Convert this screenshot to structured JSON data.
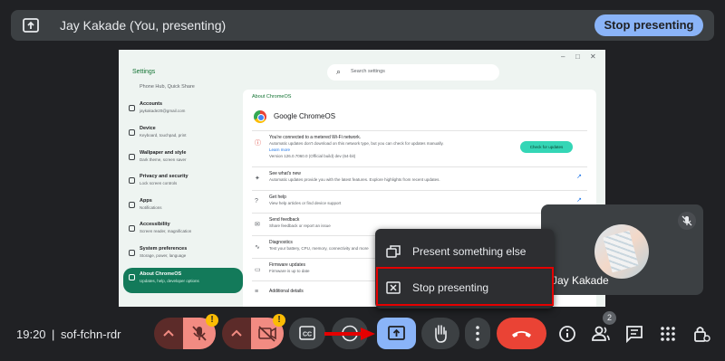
{
  "banner": {
    "title": "Jay Kakade (You, presenting)",
    "stop_label": "Stop presenting",
    "icon": "present-screen-icon"
  },
  "shared_screen": {
    "window_controls": [
      "–",
      "□",
      "✕"
    ],
    "settings_title": "Settings",
    "search_placeholder": "Search settings",
    "nav": [
      {
        "label": "Phone Hub, Quick Share",
        "sub": ""
      },
      {
        "label": "Accounts",
        "sub": "jaykakade20@gmail.com"
      },
      {
        "label": "Device",
        "sub": "Keyboard, touchpad, print"
      },
      {
        "label": "Wallpaper and style",
        "sub": "Dark theme, screen saver"
      },
      {
        "label": "Privacy and security",
        "sub": "Lock screen controls"
      },
      {
        "label": "Apps",
        "sub": "Notifications"
      },
      {
        "label": "Accessibility",
        "sub": "Screen reader, magnification"
      },
      {
        "label": "System preferences",
        "sub": "Storage, power, language"
      },
      {
        "label": "About ChromeOS",
        "sub": "Updates, help, developer options"
      }
    ],
    "panel_heading": "About ChromeOS",
    "product_name": "Google ChromeOS",
    "update_row": {
      "title": "You're connected to a metered Wi-Fi network.",
      "sub": "Automatic updates don't download on this network type, but you can check for updates manually.",
      "link": "Learn more",
      "version": "Version 126.0.7060.0 (Official build) dev (64-bit)",
      "button": "Check for updates"
    },
    "rows": [
      {
        "title": "See what's new",
        "sub": "Automatic updates provide you with the latest features. Explore highlights from recent updates.",
        "icon": "sparkle-icon"
      },
      {
        "title": "Get help",
        "sub": "View help articles or find device support",
        "icon": "help-icon"
      },
      {
        "title": "Send feedback",
        "sub": "Share feedback or report an issue",
        "icon": "feedback-icon"
      },
      {
        "title": "Diagnostics",
        "sub": "Test your battery, CPU, memory, connectivity and more",
        "icon": "diagnostics-icon"
      },
      {
        "title": "Firmware updates",
        "sub": "Firmware is up to date",
        "icon": "firmware-icon"
      },
      {
        "title": "Additional details",
        "sub": "",
        "icon": "list-icon"
      }
    ]
  },
  "self_view": {
    "name": "Jay Kakade",
    "mic_icon": "mic-off-icon"
  },
  "menu": {
    "items": [
      {
        "label": "Present something else",
        "icon": "present-something-else-icon"
      },
      {
        "label": "Stop presenting",
        "icon": "stop-presenting-icon"
      }
    ]
  },
  "toolbar": {
    "time": "19:20",
    "separator": "|",
    "meeting_code": "sof-fchn-rdr",
    "warning_mark": "!",
    "people_count": "2",
    "colors": {
      "muted_red": "#f28b82",
      "muted_bg": "#5c2b29",
      "present_active": "#8ab4f8",
      "end_call": "#ea4335",
      "highlight": "#e50000"
    }
  }
}
